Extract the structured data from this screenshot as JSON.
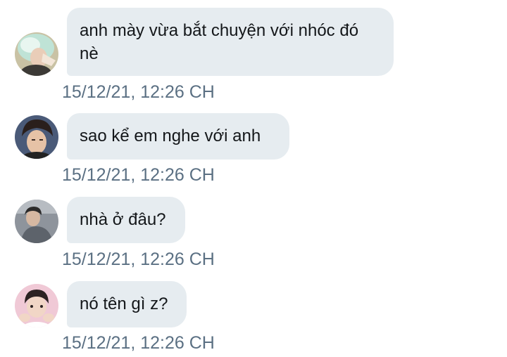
{
  "messages": [
    {
      "avatar": "avatar-light-hair",
      "text": "anh mày vừa bắt chuyện với nhóc đó nè",
      "timestamp": "15/12/21, 12:26 CH"
    },
    {
      "avatar": "avatar-dark-hair",
      "text": "sao kể em nghe với anh",
      "timestamp": "15/12/21, 12:26 CH"
    },
    {
      "avatar": "avatar-grey-outfit",
      "text": "nhà ở đâu?",
      "timestamp": "15/12/21, 12:26 CH"
    },
    {
      "avatar": "avatar-pink-background",
      "text": "nó tên gì z?",
      "timestamp": "15/12/21, 12:26 CH"
    }
  ],
  "colors": {
    "bubble": "#e6ecf0",
    "text": "#14171a",
    "timestamp": "#5b7083"
  }
}
